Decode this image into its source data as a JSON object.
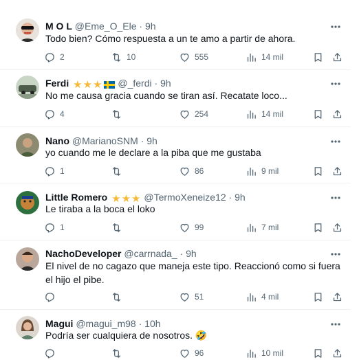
{
  "replies": [
    {
      "name": "M O L",
      "handle": "@Eme_O_Ele",
      "time": "9h",
      "text": "Todo bien? Cómo respuesta a un te amo a partir de ahora.",
      "stats": {
        "replies": "2",
        "reposts": "10",
        "likes": "555",
        "views": "14 mil"
      }
    },
    {
      "name": "Ferdi",
      "badges": [
        "star",
        "star",
        "star",
        "flag-sweden"
      ],
      "handle": "@_ferdi",
      "time": "9h",
      "text": "No me causa gracia cuando se tiran así. Recatate loco...",
      "stats": {
        "replies": "4",
        "reposts": "",
        "likes": "254",
        "views": "14 mil"
      }
    },
    {
      "name": "Nano",
      "handle": "@MarianoSNM",
      "time": "9h",
      "text": "yo cuando me le declare a la piba que me gustaba",
      "stats": {
        "replies": "1",
        "reposts": "",
        "likes": "86",
        "views": "9 mil"
      }
    },
    {
      "name": "Little Romero",
      "badges": [
        "star",
        "star",
        "star"
      ],
      "handle": "@TermoXeneize12",
      "time": "9h",
      "text": "Le tiraba a la boca el loko",
      "stats": {
        "replies": "1",
        "reposts": "",
        "likes": "99",
        "views": "7 mil"
      }
    },
    {
      "name": "NachoDeveloper",
      "handle": "@carrnada_",
      "time": "9h",
      "text": "El nivel de no cagazo que maneja este tipo. Reaccionó como si fuera el hijo el pibe.",
      "stats": {
        "replies": "",
        "reposts": "",
        "likes": "51",
        "views": "4 mil"
      }
    },
    {
      "name": "Magui",
      "handle": "@magui_m98",
      "time": "10h",
      "text": "Podría ser cualquiera de nosotros. 🤣",
      "stats": {
        "replies": "",
        "reposts": "",
        "likes": "96",
        "views": "10 mil"
      }
    }
  ],
  "separator": "·",
  "icons": {
    "reply": "reply-icon",
    "repost": "repost-icon",
    "like": "heart-icon",
    "views": "views-icon",
    "bookmark": "bookmark-icon",
    "share": "share-icon",
    "more": "more-icon"
  }
}
